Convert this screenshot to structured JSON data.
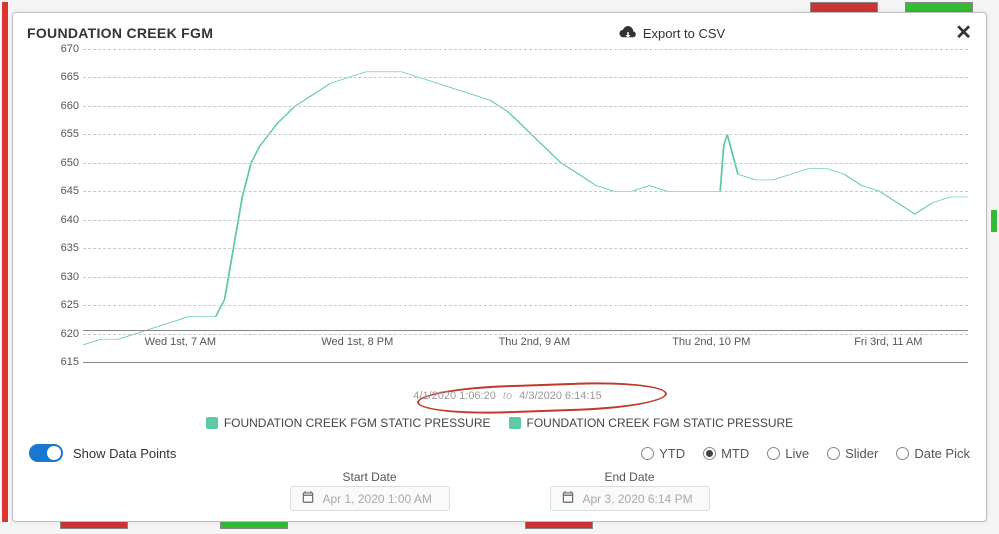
{
  "header": {
    "title": "FOUNDATION CREEK FGM",
    "export_label": "Export to CSV"
  },
  "chart_data": {
    "type": "line",
    "title": "FOUNDATION CREEK FGM",
    "ylabel": "",
    "xlabel": "",
    "ylim": [
      615,
      670
    ],
    "y_ticks": [
      615,
      620,
      625,
      630,
      635,
      640,
      645,
      650,
      655,
      660,
      665,
      670
    ],
    "x_ticks": [
      "Wed 1st, 7 AM",
      "Wed 1st, 8 PM",
      "Thu 2nd, 9 AM",
      "Thu 2nd, 10 PM",
      "Fri 3rd, 11 AM"
    ],
    "range_from": "4/1/2020  1:06:20",
    "range_to_word": "to",
    "range_to": "4/3/2020  6:14:15",
    "series": [
      {
        "name": "FOUNDATION CREEK FGM STATIC PRESSURE",
        "color": "#5cc9a7",
        "x": [
          0.0,
          0.02,
          0.04,
          0.06,
          0.08,
          0.1,
          0.12,
          0.14,
          0.15,
          0.16,
          0.17,
          0.18,
          0.19,
          0.2,
          0.22,
          0.24,
          0.26,
          0.28,
          0.3,
          0.32,
          0.34,
          0.36,
          0.38,
          0.4,
          0.42,
          0.44,
          0.46,
          0.48,
          0.5,
          0.52,
          0.54,
          0.56,
          0.58,
          0.6,
          0.62,
          0.64,
          0.66,
          0.68,
          0.7,
          0.72,
          0.724,
          0.728,
          0.74,
          0.76,
          0.78,
          0.8,
          0.82,
          0.84,
          0.86,
          0.88,
          0.9,
          0.92,
          0.94,
          0.96,
          0.98,
          1.0
        ],
        "values": [
          618,
          619,
          619,
          620,
          621,
          622,
          623,
          623,
          623,
          626,
          635,
          644,
          650,
          653,
          657,
          660,
          662,
          664,
          665,
          666,
          666,
          666,
          665,
          664,
          663,
          662,
          661,
          659,
          656,
          653,
          650,
          648,
          646,
          645,
          645,
          646,
          645,
          645,
          645,
          645,
          653,
          655,
          648,
          647,
          647,
          648,
          649,
          649,
          648,
          646,
          645,
          643,
          641,
          643,
          644,
          644
        ]
      },
      {
        "name": "FOUNDATION CREEK FGM STATIC PRESSURE",
        "color": "#5cc9a7"
      }
    ]
  },
  "legend": {
    "items": [
      {
        "label": "FOUNDATION CREEK FGM STATIC PRESSURE"
      },
      {
        "label": "FOUNDATION CREEK FGM STATIC PRESSURE"
      }
    ]
  },
  "controls": {
    "show_data_points_label": "Show Data Points",
    "show_data_points_on": true,
    "range_modes": [
      {
        "label": "YTD",
        "checked": false
      },
      {
        "label": "MTD",
        "checked": true
      },
      {
        "label": "Live",
        "checked": false
      },
      {
        "label": "Slider",
        "checked": false
      },
      {
        "label": "Date Pick",
        "checked": false
      }
    ]
  },
  "dates": {
    "start_label": "Start Date",
    "start_value": "Apr 1, 2020 1:00 AM",
    "end_label": "End Date",
    "end_value": "Apr 3, 2020 6:14 PM"
  }
}
